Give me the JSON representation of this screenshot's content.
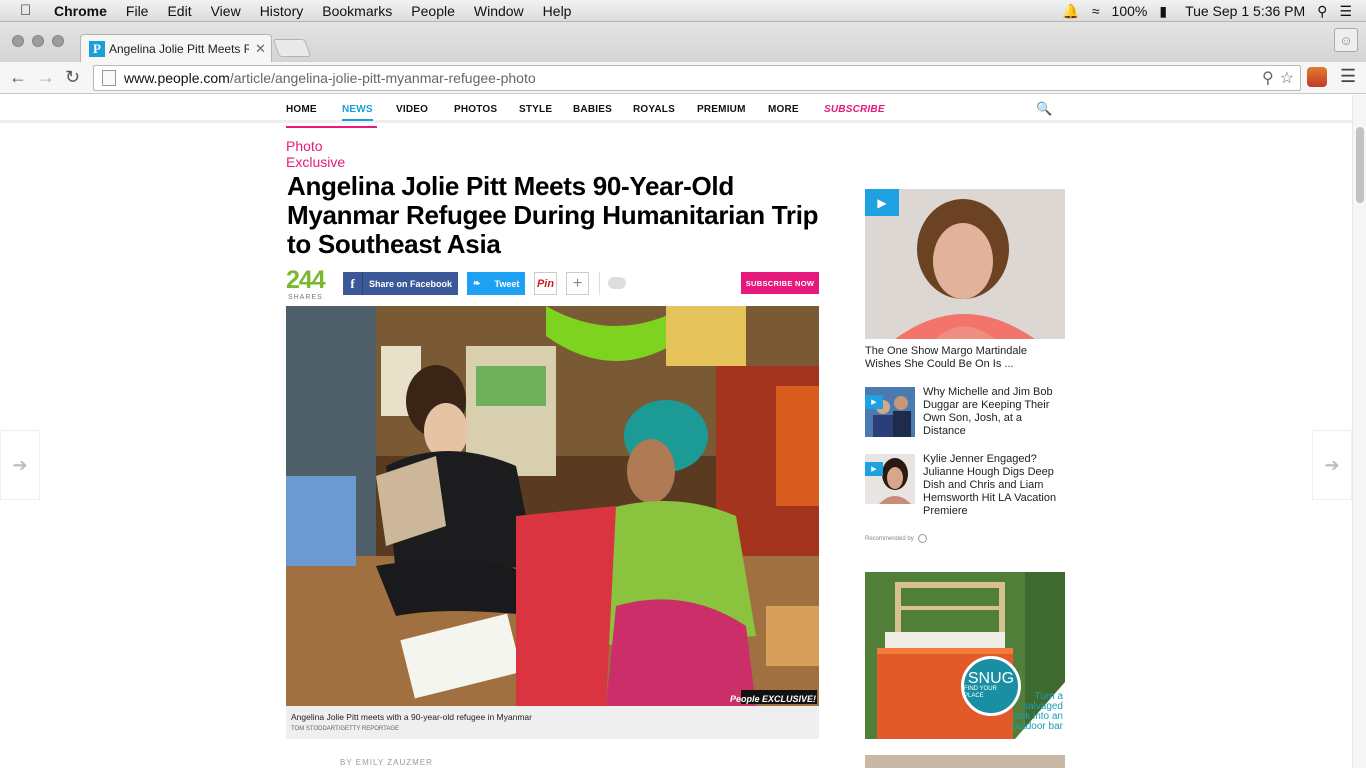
{
  "menubar": {
    "app": "Chrome",
    "items": [
      "File",
      "Edit",
      "View",
      "History",
      "Bookmarks",
      "People",
      "Window",
      "Help"
    ],
    "battery": "100%",
    "datetime": "Tue Sep 1  5:36 PM"
  },
  "browser": {
    "tab_title": "Angelina Jolie Pitt Meets R",
    "url_host": "www.people.com",
    "url_path": "/article/angelina-jolie-pitt-myanmar-refugee-photo"
  },
  "site_nav": {
    "items": [
      "HOME",
      "NEWS",
      "VIDEO",
      "PHOTOS",
      "STYLE",
      "BABIES",
      "ROYALS",
      "PREMIUM",
      "MORE",
      "SUBSCRIBE"
    ],
    "active": "NEWS"
  },
  "article": {
    "kicker": "Photo Exclusive",
    "headline": "Angelina Jolie Pitt Meets 90-Year-Old Myanmar Refugee During Humanitarian Trip to Southeast Asia",
    "share_count": "244",
    "share_label": "SHARES",
    "facebook_label": "Share on Facebook",
    "tweet_label": "Tweet",
    "pin_label": "Pin",
    "subscribe_label": "SUBSCRIBE NOW",
    "photo_watermark": "People EXCLUSIVE!",
    "caption": "Angelina Jolie Pitt meets with a 90-year-old refugee in Myanmar",
    "credit": "TOM STODDART/GETTY REPORTAGE",
    "byline": "BY EMILY ZAUZMER"
  },
  "sidebar": {
    "video_title": "The One Show Margo Martindale Wishes She Could Be On Is ...",
    "recs": [
      {
        "title": "Why Michelle and Jim Bob Duggar are Keeping Their Own Son, Josh, at a Distance"
      },
      {
        "title": "Kylie Jenner Engaged? Julianne Hough Digs Deep Dish and Chris and Liam Hemsworth Hit LA Vacation Premiere"
      }
    ],
    "recommended_by": "Recommended by",
    "ad": {
      "logo_main": "SNUG",
      "logo_sub": "FIND YOUR PLACE",
      "teaser": "Turn a salvaged sink into an outdoor bar"
    }
  },
  "colors": {
    "accent_pink": "#e6197c",
    "accent_blue": "#1a9fd9",
    "share_green": "#7ab82f",
    "facebook": "#3b5998",
    "twitter": "#1da1f2"
  }
}
